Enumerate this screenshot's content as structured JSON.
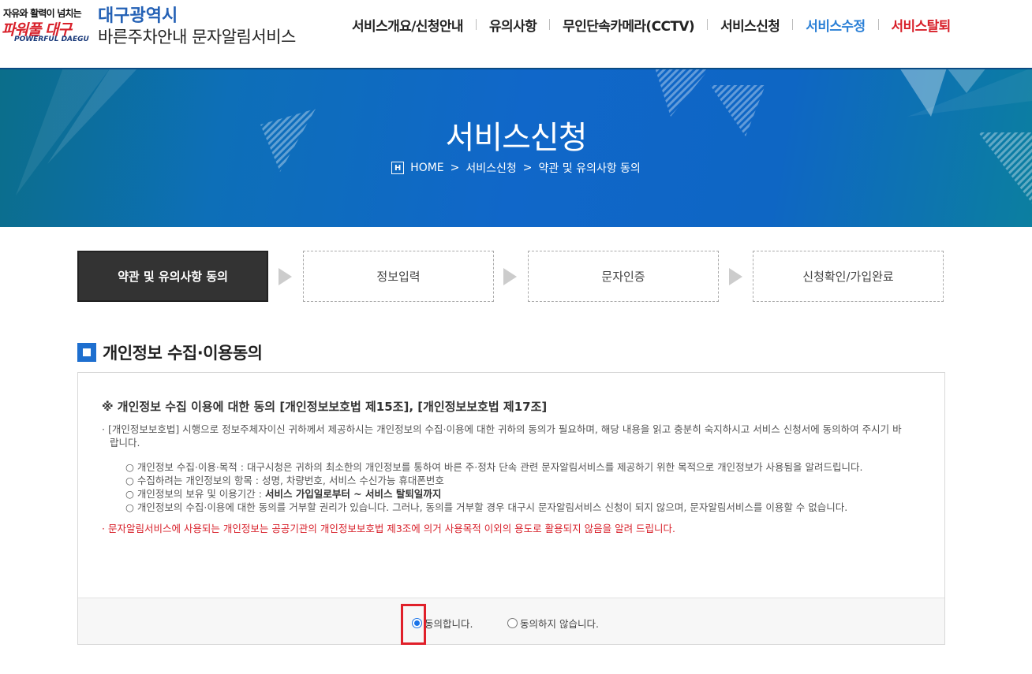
{
  "header": {
    "logo": {
      "slogan": "자유와 활력이 넘치는",
      "main": "파워풀 대구",
      "eng": "POWERFUL DAEGU"
    },
    "city": "대구광역시",
    "service_name": "바른주차안내 문자알림서비스",
    "nav": [
      {
        "label": "서비스개요/신청안내"
      },
      {
        "label": "유의사항"
      },
      {
        "label": "무인단속카메라(CCTV)"
      },
      {
        "label": "서비스신청"
      },
      {
        "label": "서비스수정"
      },
      {
        "label": "서비스탈퇴"
      }
    ]
  },
  "banner": {
    "title": "서비스신청",
    "breadcrumb": [
      "HOME",
      "서비스신청",
      "약관 및 유의사항 동의"
    ],
    "home_icon_letter": "H",
    "separator": ">"
  },
  "steps": [
    {
      "label": "약관 및 유의사항 동의",
      "active": true
    },
    {
      "label": "정보입력",
      "active": false
    },
    {
      "label": "문자인증",
      "active": false
    },
    {
      "label": "신청확인/가입완료",
      "active": false
    }
  ],
  "section": {
    "title": "개인정보 수집·이용동의",
    "terms_heading": "※ 개인정보 수집 이용에 대한 동의 [개인정보보호법 제15조], [개인정보보호법 제17조]",
    "intro": "· [개인정보보호법] 시행으로 정보주체자이신 귀하께서 제공하시는 개인정보의 수집·이용에 대한 귀하의 동의가 필요하며, 해당 내용을 읽고 충분히 숙지하시고 서비스 신청서에 동의하여 주시기 바랍니다.",
    "items": [
      {
        "text": "○ 개인정보 수집·이용·목적 : 대구시청은 귀하의 최소한의 개인정보를 통하여 바른 주·정차 단속 관련 문자알림서비스를 제공하기 위한 목적으로 개인정보가 사용됨을 알려드립니다."
      },
      {
        "text": "○ 수집하려는 개인정보의 항목 : 성명, 차량번호, 서비스 수신가능 휴대폰번호"
      },
      {
        "text_prefix": "○ 개인정보의 보유 및 이용기간 : ",
        "text_bold": "서비스 가입일로부터 ~ 서비스 탈퇴일까지"
      },
      {
        "text": "○ 개인정보의 수집·이용에 대한 동의를 거부할 권리가 있습니다. 그러나, 동의를 거부할 경우 대구시 문자알림서비스 신청이 되지 않으며, 문자알림서비스를 이용할 수 없습니다."
      }
    ],
    "notice": "· 문자알림서비스에 사용되는 개인정보는 공공기관의 개인정보보호법 제3조에 의거 사용목적 이외의 용도로 활용되지 않음을 알려 드립니다.",
    "agree_label": "동의합니다.",
    "disagree_label": "동의하지 않습니다.",
    "agree_selected": true
  },
  "colors": {
    "accent_blue": "#1e6fcf",
    "nav_blue": "#2a7fd6",
    "nav_red": "#d8202a",
    "highlight_red": "#e0202a"
  }
}
